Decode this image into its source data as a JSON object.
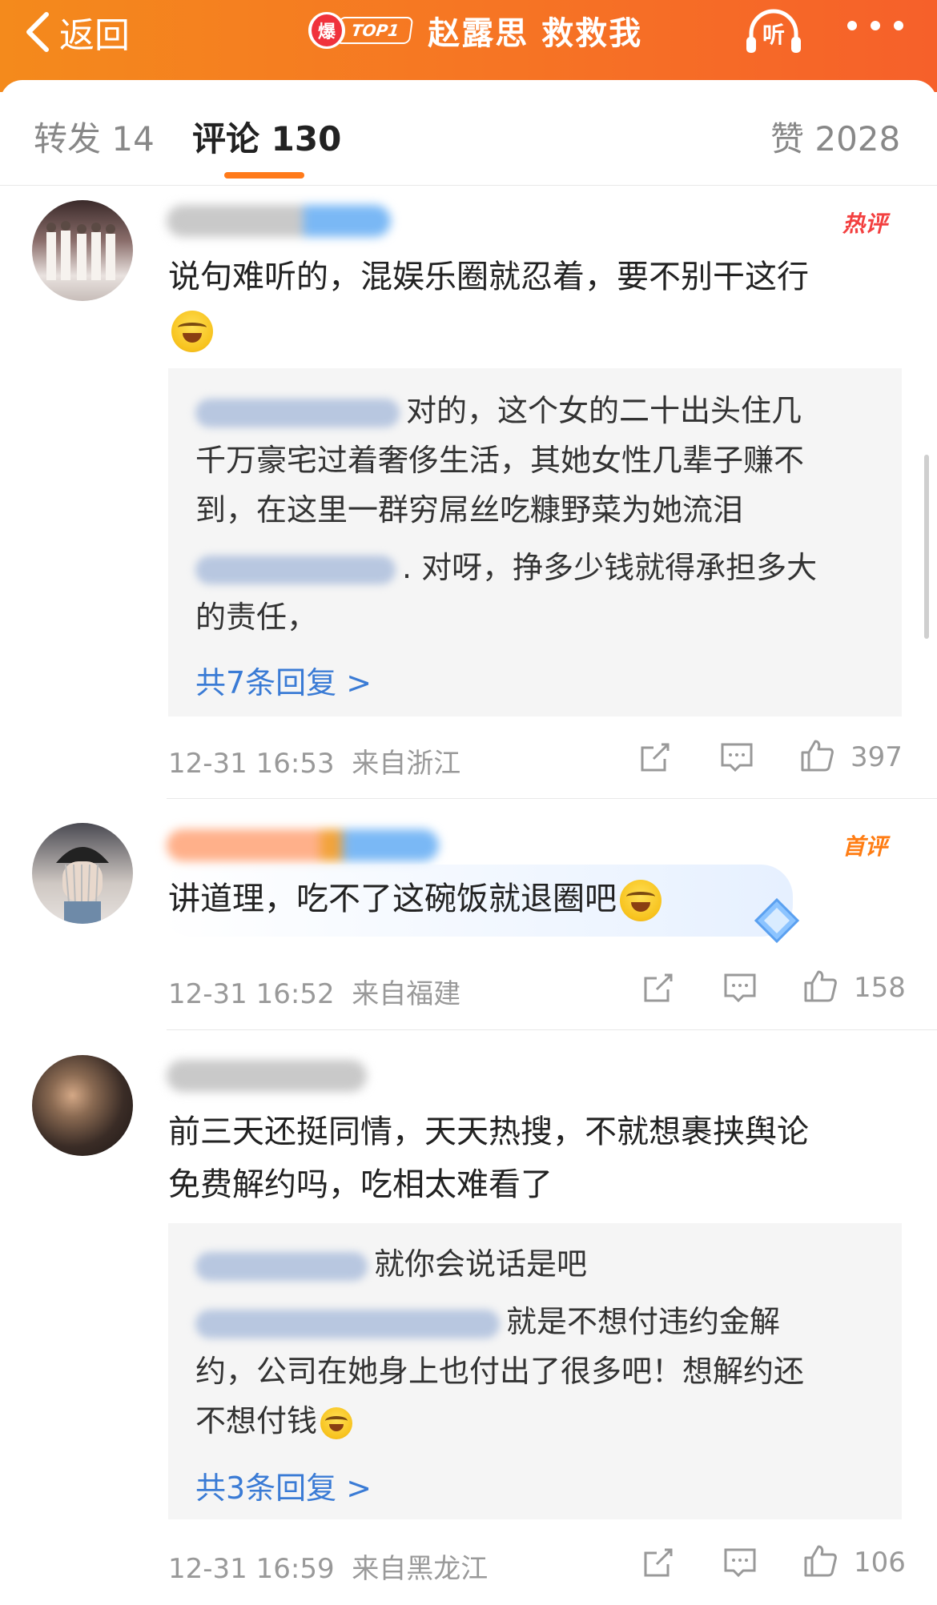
{
  "header": {
    "back_label": "返回",
    "hot_icon_label": "爆",
    "top_badge": "TOP1",
    "title": "赵露思 救救我",
    "listen_label": "听"
  },
  "tabs": {
    "repost": "转发 14",
    "comments": "评论 130",
    "likes": "赞 2028"
  },
  "comments": [
    {
      "badge": "热评",
      "text": "说句难听的，混娱乐圈就忍着，要不别干这行",
      "replies": [
        {
          "text": "对的，这个女的二十出头住几"
        },
        {
          "text": "千万豪宅过着奢侈生活，其她女性几辈子赚不"
        },
        {
          "text": "到，在这里一群穷屌丝吃糠野菜为她流泪"
        },
        {
          "text": ". 对呀，挣多少钱就得承担多大"
        },
        {
          "text": "的责任，"
        }
      ],
      "more_replies": "共7条回复 >",
      "time": "12-31 16:53",
      "location": "来自浙江",
      "likes": "397"
    },
    {
      "badge": "首评",
      "text": "讲道理，吃不了这碗饭就退圈吧",
      "time": "12-31 16:52",
      "location": "来自福建",
      "likes": "158"
    },
    {
      "text_line1": "前三天还挺同情，天天热搜，不就想裹挟舆论",
      "text_line2": "免费解约吗，吃相太难看了",
      "replies": [
        {
          "text": "就你会说话是吧"
        },
        {
          "text": "就是不想付违约金解"
        },
        {
          "text": "约，公司在她身上也付出了很多吧！想解约还"
        },
        {
          "text": "不想付钱"
        }
      ],
      "more_replies": "共3条回复 >",
      "time": "12-31 16:59",
      "location": "来自黑龙江",
      "likes": "106"
    }
  ],
  "colors": {
    "header_start": "#f48a1c",
    "header_end": "#f6602a",
    "tab_indicator": "#ff7a1a",
    "link": "#3a7bd5",
    "hot_badge": "#f34040",
    "first_badge": "#ff7d14"
  },
  "icons": [
    "chevron-left-icon",
    "headphones-icon",
    "more-dots-icon",
    "share-icon",
    "comment-icon",
    "like-icon",
    "emoji-laugh-cry-icon",
    "diamond-icon"
  ]
}
